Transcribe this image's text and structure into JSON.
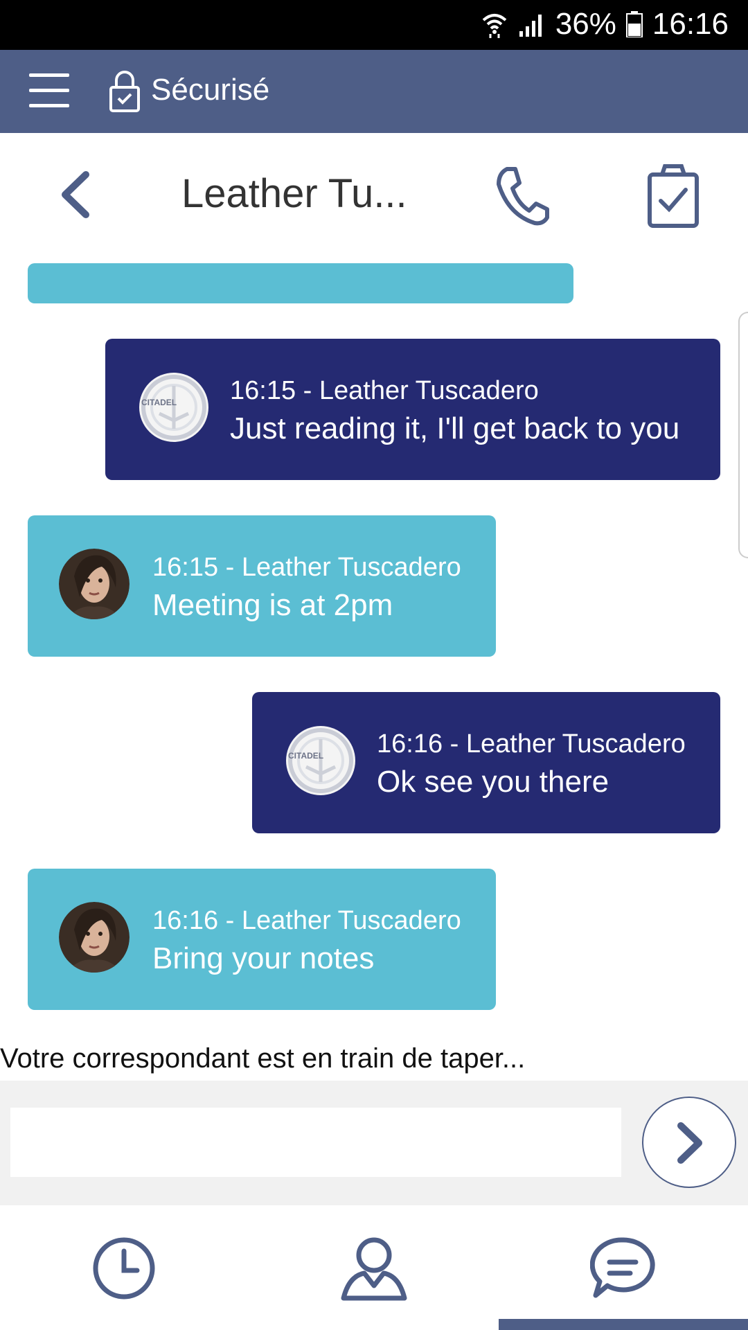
{
  "status_bar": {
    "battery": "36%",
    "time": "16:16"
  },
  "app_bar": {
    "secure_label": "Sécurisé"
  },
  "chat_header": {
    "title": "Leather Tu..."
  },
  "messages": [
    {
      "direction": "out",
      "meta": "16:15 - Leather Tuscadero",
      "text": "Just reading it, I'll get back to you",
      "avatar": "CITADEL"
    },
    {
      "direction": "in",
      "meta": "16:15 - Leather Tuscadero",
      "text": "Meeting is at 2pm"
    },
    {
      "direction": "out",
      "meta": "16:16 - Leather Tuscadero",
      "text": "Ok see you there",
      "avatar": "CITADEL"
    },
    {
      "direction": "in",
      "meta": "16:16 - Leather Tuscadero",
      "text": "Bring your notes"
    }
  ],
  "typing_indicator": "Votre correspondant est en train de taper...",
  "composer": {
    "value": "",
    "placeholder": ""
  },
  "colors": {
    "app_bar": "#4e5e87",
    "incoming_bubble": "#5bbed3",
    "outgoing_bubble": "#252a72",
    "icon": "#4e5e87"
  },
  "bottom_nav": {
    "items": [
      "history-icon",
      "contact-icon",
      "chat-icon"
    ],
    "active": "chat-icon"
  }
}
